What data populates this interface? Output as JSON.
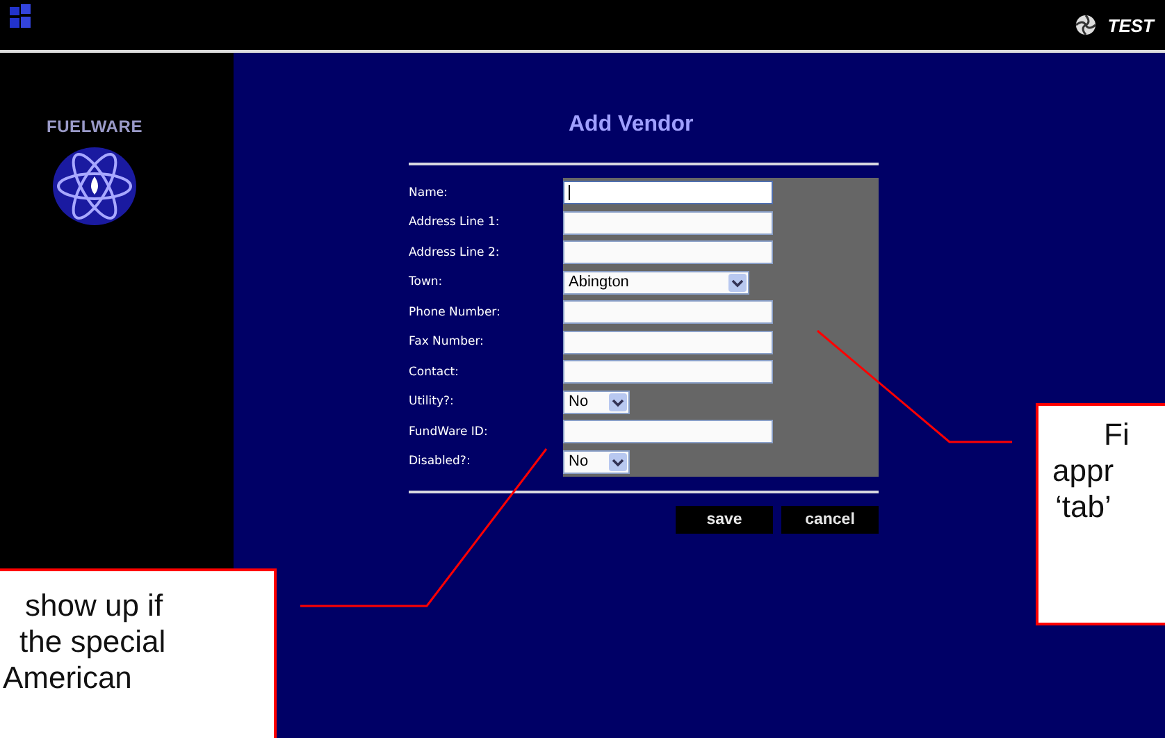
{
  "top_bar": {
    "label": "TEST"
  },
  "brand": {
    "name": "FUELWARE"
  },
  "form": {
    "title": "Add Vendor",
    "fields": [
      {
        "label": "Name:",
        "kind": "text",
        "focused": true
      },
      {
        "label": "Address Line 1:",
        "kind": "text",
        "focused": false
      },
      {
        "label": "Address Line 2:",
        "kind": "text",
        "focused": false
      },
      {
        "label": "Town:",
        "kind": "select",
        "value": "Abington"
      },
      {
        "label": "Phone Number:",
        "kind": "text",
        "focused": false
      },
      {
        "label": "Fax Number:",
        "kind": "text",
        "focused": false
      },
      {
        "label": "Contact:",
        "kind": "text",
        "focused": false
      },
      {
        "label": "Utility?:",
        "kind": "yesno",
        "value": "No"
      },
      {
        "label": "FundWare ID:",
        "kind": "text",
        "focused": false
      },
      {
        "label": "Disabled?:",
        "kind": "yesno",
        "value": "No"
      }
    ],
    "buttons": [
      "save",
      "cancel"
    ]
  },
  "callouts": [
    {
      "lines": [
        "Fi",
        "appr",
        "‘tab’"
      ]
    },
    {
      "lines": [
        "show up if",
        "the special",
        "American"
      ]
    }
  ]
}
